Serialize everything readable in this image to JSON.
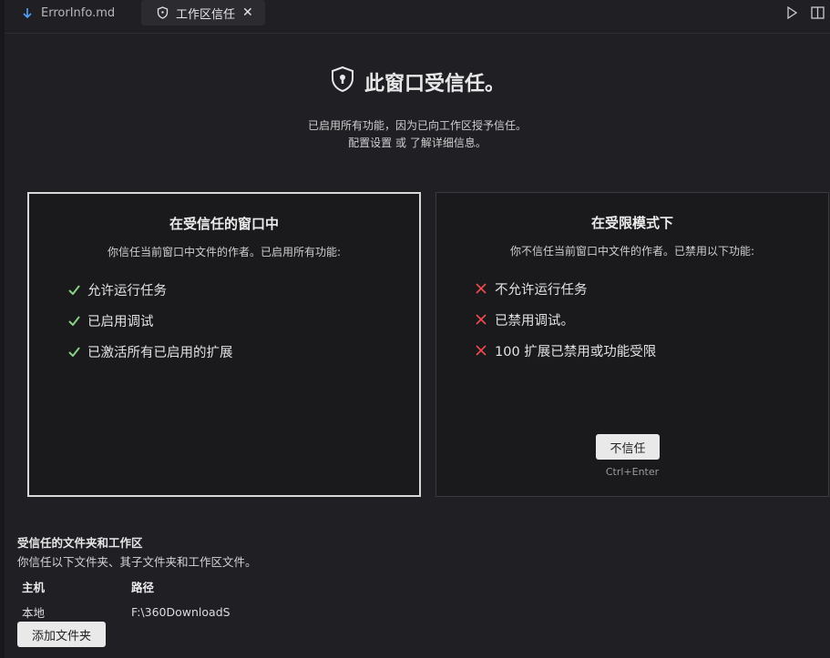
{
  "tabs": [
    {
      "label": "ErrorInfo.md",
      "icon": "arrow-down-icon"
    },
    {
      "label": "工作区信任",
      "icon": "shield-icon",
      "close": "✕"
    }
  ],
  "header": {
    "title": "此窗口受信任。",
    "subtitle_line1": "已启用所有功能，因为已向工作区授予信任。",
    "subtitle_line2_link1": "配置设置",
    "subtitle_line2_mid": " 或 ",
    "subtitle_line2_link2": "了解详细信息",
    "subtitle_line2_end": "。"
  },
  "trusted_card": {
    "title": "在受信任的窗口中",
    "desc": "你信任当前窗口中文件的作者。已启用所有功能:",
    "items": [
      "允许运行任务",
      "已启用调试",
      "已激活所有已启用的扩展"
    ]
  },
  "restricted_card": {
    "title": "在受限模式下",
    "desc": "你不信任当前窗口中文件的作者。已禁用以下功能:",
    "items": [
      "不允许运行任务",
      "已禁用调试。",
      "100 扩展已禁用或功能受限"
    ],
    "button": "不信任",
    "shortcut": "Ctrl+Enter"
  },
  "trusted_folders": {
    "title": "受信任的文件夹和工作区",
    "desc": "你信任以下文件夹、其子文件夹和工作区文件。",
    "col_host": "主机",
    "col_path": "路径",
    "rows": [
      {
        "host": "本地",
        "path": "F:\\360DownloadS"
      }
    ],
    "add_button": "添加文件夹"
  },
  "colors": {
    "check": "#89d185",
    "cross": "#f14c4c",
    "background": "#1f1f24"
  }
}
